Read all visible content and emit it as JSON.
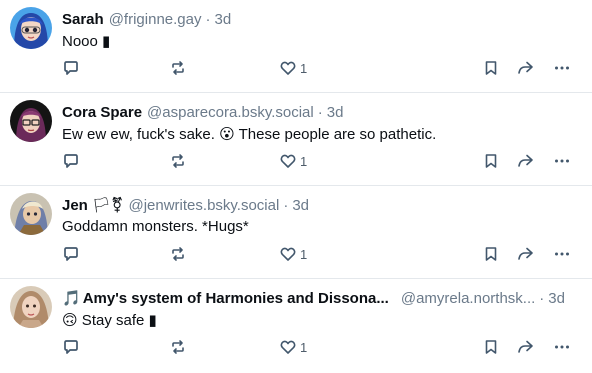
{
  "posts": [
    {
      "display_name": "Sarah",
      "handle": "@friginne.gay",
      "separator": "·",
      "time": "3d",
      "text": "Nooo ",
      "text_emoji": "▮",
      "like_count": "1",
      "avatar_color": "#3a7bd5"
    },
    {
      "display_name": "Cora Spare",
      "handle": "@asparecora.bsky.social",
      "separator": "·",
      "time": "3d",
      "text": "Ew ew ew, fuck's sake. ",
      "text_emoji": "😮",
      "text_after": " These people are so pathetic.",
      "like_count": "1",
      "avatar_color": "#1a1a1a"
    },
    {
      "display_name": "Jen",
      "name_badges": "🏳⚧",
      "handle": "@jenwrites.bsky.social",
      "separator": "·",
      "time": "3d",
      "text": "Goddamn monsters. *Hugs*",
      "like_count": "1",
      "avatar_color": "#6f7fa8"
    },
    {
      "name_prefix": "🎵",
      "display_name": "Amy's system of Harmonies and Dissona...",
      "handle": "@amyrela.northsk...",
      "separator": "·",
      "time": "3d",
      "text_emoji": "🙃",
      "text": " Stay safe ",
      "text_emoji_end": "▮",
      "like_count": "1",
      "avatar_color": "#b08b6a"
    }
  ],
  "colors": {
    "icon": "#42576c",
    "muted_text": "#6b7a8a",
    "divider": "#e4e8ec"
  },
  "icons": [
    "reply-icon",
    "repost-icon",
    "heart-icon",
    "bookmark-icon",
    "share-icon",
    "more-icon"
  ]
}
